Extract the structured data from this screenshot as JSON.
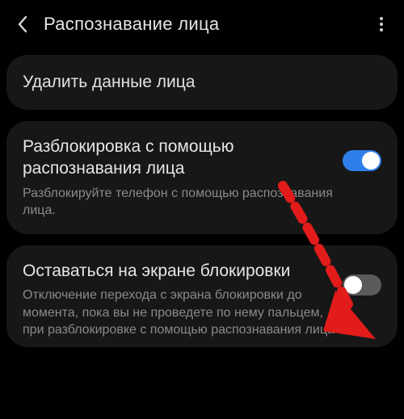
{
  "header": {
    "title": "Распознавание лица"
  },
  "delete_card": {
    "title": "Удалить данные лица"
  },
  "unlock_card": {
    "title": "Разблокировка с помощью распознавания лица",
    "desc": "Разблокируйте телефон с помощью распознавания лица.",
    "toggle_on": true
  },
  "stay_card": {
    "title": "Оставаться на экране блокировки",
    "desc": "Отключение перехода с экрана блокировки до момента, пока вы не проведете по нему пальцем, при разблокировке с помощью распознавания лица",
    "toggle_on": false
  },
  "annotation": {
    "arrow_color": "#e21b1b"
  }
}
